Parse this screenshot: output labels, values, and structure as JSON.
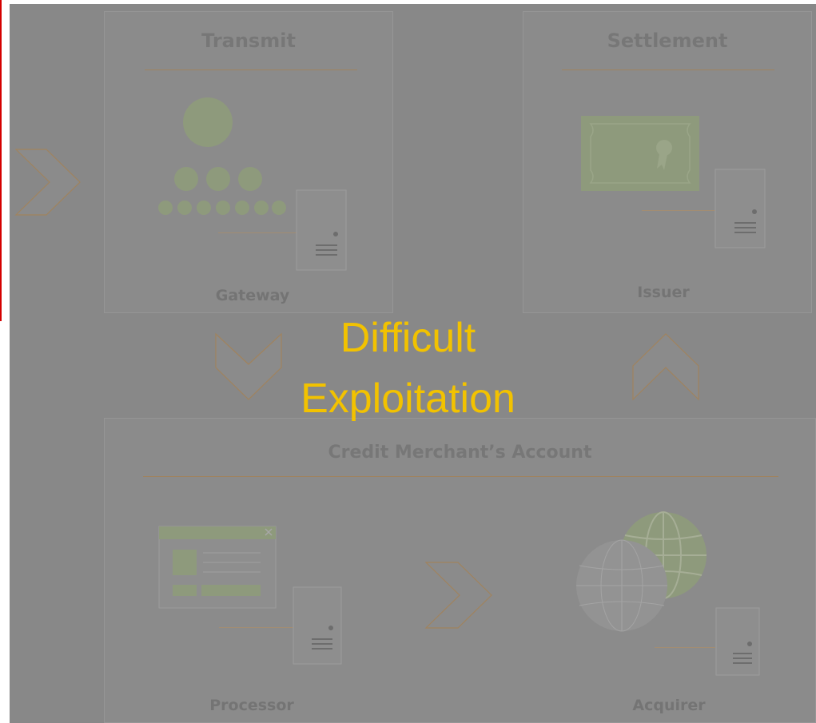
{
  "overlay": {
    "line1": "Difficult",
    "line2": "Exploitation",
    "color": "#f2c200"
  },
  "boxes": {
    "transmit": {
      "title": "Transmit",
      "label": "Gateway"
    },
    "settlement": {
      "title": "Settlement",
      "label": "Issuer"
    },
    "credit": {
      "title": "Credit Merchant’s Account",
      "processor_label": "Processor",
      "acquirer_label": "Acquirer"
    }
  },
  "icons": [
    "hierarchy-icon",
    "certificate-icon",
    "server-icon",
    "browser-window-icon",
    "globe-icon",
    "chevron-arrow-icon"
  ],
  "colors": {
    "background": "#888888",
    "accent_line": "#a0835e",
    "icon_green": "#8e9a7c",
    "marker_red": "#d40000"
  }
}
